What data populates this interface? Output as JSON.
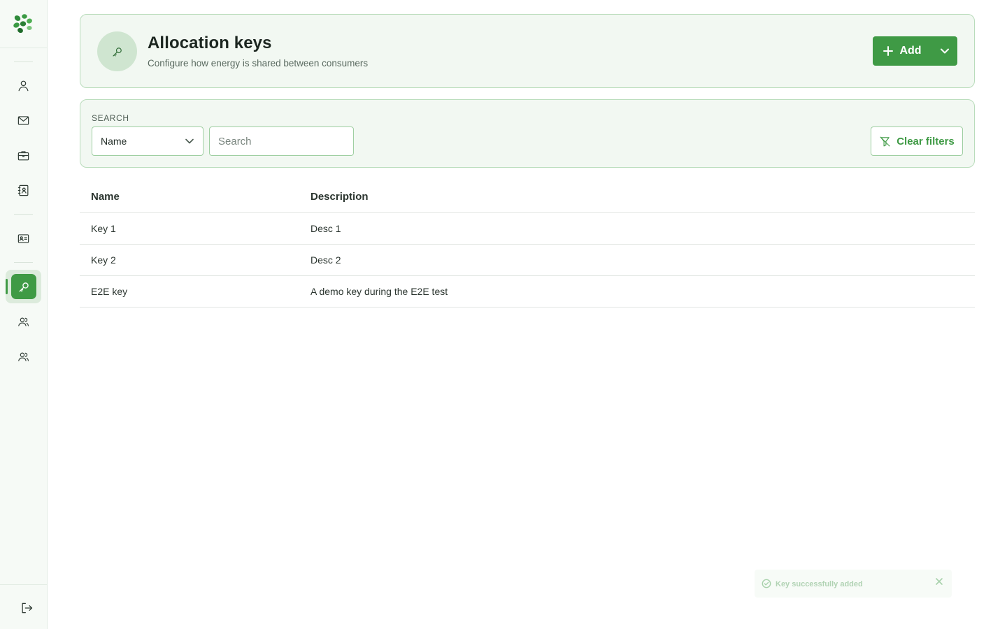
{
  "header": {
    "title": "Allocation keys",
    "subtitle": "Configure how energy is shared between consumers",
    "add_label": "Add"
  },
  "sidebar": {
    "items": [
      {
        "icon": "user-icon"
      },
      {
        "icon": "mail-icon"
      },
      {
        "icon": "briefcase-icon"
      },
      {
        "icon": "contact-book-icon"
      },
      {
        "icon": "id-card-icon"
      },
      {
        "icon": "key-icon",
        "active": true
      },
      {
        "icon": "users-icon"
      },
      {
        "icon": "users-icon"
      }
    ],
    "logout_icon": "logout-icon"
  },
  "search": {
    "label": "SEARCH",
    "field_selected": "Name",
    "placeholder": "Search",
    "clear_label": "Clear filters"
  },
  "table": {
    "columns": [
      "Name",
      "Description"
    ],
    "rows": [
      {
        "name": "Key 1",
        "description": "Desc 1"
      },
      {
        "name": "Key 2",
        "description": "Desc 2"
      },
      {
        "name": "E2E key",
        "description": "A demo key during the E2E test"
      }
    ]
  },
  "toast": {
    "message": "Key successfully added"
  },
  "colors": {
    "accent": "#3f9a45",
    "card_bg": "#f2f8f2",
    "card_border": "#b9dcbb",
    "sidebar_bg": "#f6faf6"
  }
}
